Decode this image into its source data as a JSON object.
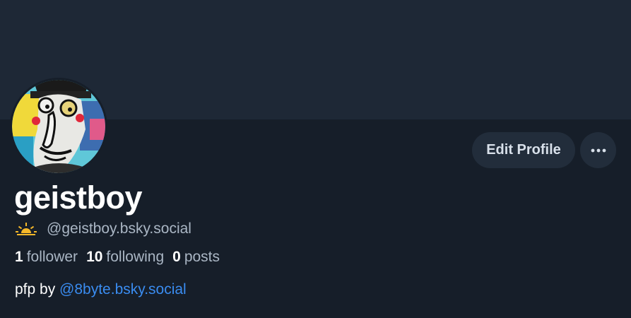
{
  "profile": {
    "display_name": "geistboy",
    "handle": "@geistboy.bsky.social",
    "handle_icon": "sun-rising-icon",
    "stats": {
      "followers_count": "1",
      "followers_label": "follower",
      "following_count": "10",
      "following_label": "following",
      "posts_count": "0",
      "posts_label": "posts"
    },
    "bio": {
      "prefix": "pfp by",
      "mention": "@8byte.bsky.social"
    }
  },
  "actions": {
    "edit_label": "Edit Profile",
    "more_icon": "more-horizontal-icon"
  },
  "colors": {
    "banner": "#1e2836",
    "background": "#161e29",
    "button_bg": "#222d3b",
    "link": "#3a8cf0",
    "sun_icon": "#f5b82a"
  }
}
